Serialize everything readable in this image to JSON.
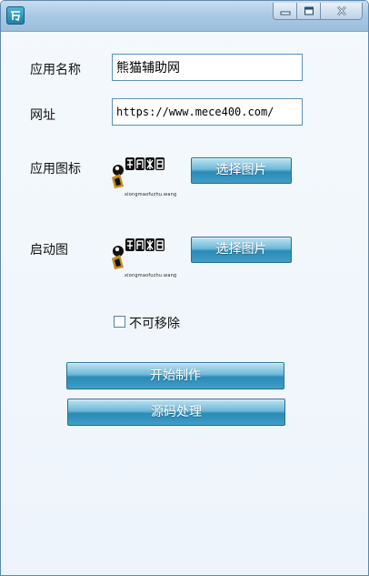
{
  "colors": {
    "titlebar": "#a9c8e2",
    "window_bg": "#f2f7fc",
    "button_blue": "#3b97c4",
    "input_border": "#5a8fb8"
  },
  "titlebar": {
    "icon": "easy-language-icon",
    "minimize_icon": "minimize-icon",
    "maximize_icon": "maximize-icon",
    "close_icon": "close-icon"
  },
  "form": {
    "app_name_label": "应用名称",
    "app_name_value": "熊猫辅助网",
    "url_label": "网址",
    "url_value": "https://www.mece400.com/",
    "app_icon_label": "应用图标",
    "splash_label": "启动图",
    "select_image_label": "选择图片",
    "logo_icon": "panda-logo-icon",
    "logo_caption": "xiongmaofuzhu.wang",
    "not_removable_label": "不可移除"
  },
  "actions": {
    "start_label": "开始制作",
    "source_label": "源码处理"
  }
}
